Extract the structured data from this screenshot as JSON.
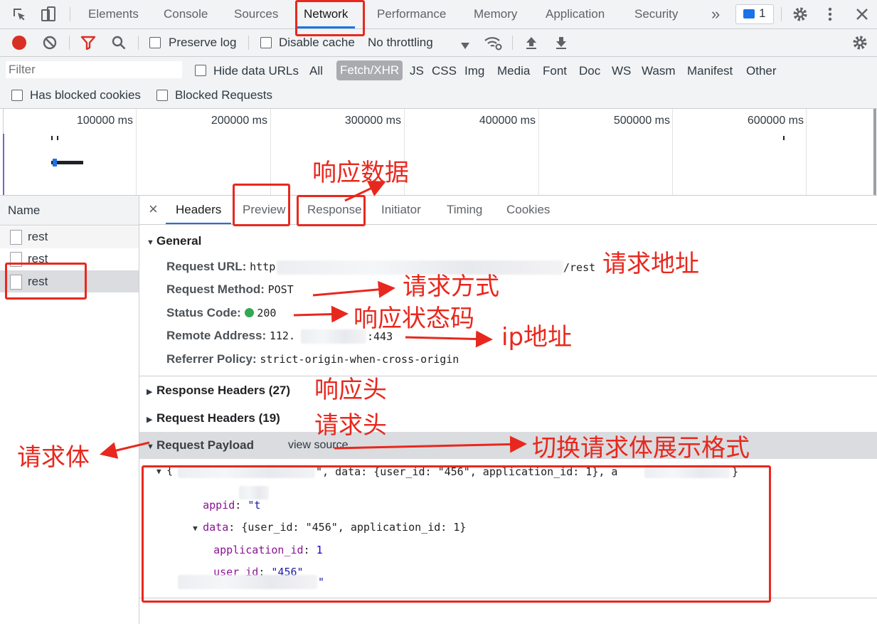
{
  "tabs": [
    {
      "label": "Elements"
    },
    {
      "label": "Console"
    },
    {
      "label": "Sources"
    },
    {
      "label": "Network"
    },
    {
      "label": "Performance"
    },
    {
      "label": "Memory"
    },
    {
      "label": "Application"
    },
    {
      "label": "Security"
    }
  ],
  "more_tabs_glyph": "»",
  "messages_badge": "1",
  "toolbar": {
    "preserve_log": "Preserve log",
    "disable_cache": "Disable cache",
    "throttling": "No throttling"
  },
  "filter": {
    "placeholder": "Filter",
    "hide_data_urls": "Hide data URLs",
    "types": [
      "All",
      "Fetch/XHR",
      "JS",
      "CSS",
      "Img",
      "Media",
      "Font",
      "Doc",
      "WS",
      "Wasm",
      "Manifest",
      "Other"
    ],
    "active_type": "Fetch/XHR",
    "has_blocked_cookies": "Has blocked cookies",
    "blocked_requests": "Blocked Requests"
  },
  "overview": {
    "ticks": [
      "100000 ms",
      "200000 ms",
      "300000 ms",
      "400000 ms",
      "500000 ms",
      "600000 ms"
    ]
  },
  "requests": {
    "header": "Name",
    "items": [
      {
        "name": "rest"
      },
      {
        "name": "rest"
      },
      {
        "name": "rest"
      }
    ]
  },
  "details": {
    "close": "×",
    "tabs": [
      "Headers",
      "Preview",
      "Response",
      "Initiator",
      "Timing",
      "Cookies"
    ],
    "general": {
      "title": "General",
      "url_label": "Request URL:",
      "url_prefix": "http",
      "url_suffix": "/rest",
      "method_label": "Request Method:",
      "method": "POST",
      "status_label": "Status Code:",
      "status": "200",
      "status_color": "#34a853",
      "remote_label": "Remote Address:",
      "remote_prefix": "112.",
      "remote_suffix": ":443",
      "referrer_label": "Referrer Policy:",
      "referrer": "strict-origin-when-cross-origin"
    },
    "response_headers": "Response Headers (27)",
    "request_headers": "Request Headers (19)",
    "payload": {
      "title": "Request Payload",
      "view_source": "view source",
      "summary_prefix": "{",
      "summary_middle": "\", data: {user_id: \"456\", application_id: 1}, a",
      "summary_end": "}",
      "appid_key": "appid",
      "appid_prefix": "\"t",
      "data_key": "data",
      "data_summary": "{user_id: \"456\", application_id: 1}",
      "application_id_key": "application_id",
      "application_id_value": "1",
      "user_id_key": "user_id",
      "user_id_value": "\"456\"",
      "last_suffix": "\""
    }
  },
  "annotations": {
    "response_data": "响应数据",
    "request_url": "请求地址",
    "request_method": "请求方式",
    "status_code": "响应状态码",
    "ip_address": "ip地址",
    "response_headers": "响应头",
    "request_headers": "请求头",
    "request_body": "请求体",
    "toggle_format": "切换请求体展示格式",
    "color": "#e8281e"
  }
}
